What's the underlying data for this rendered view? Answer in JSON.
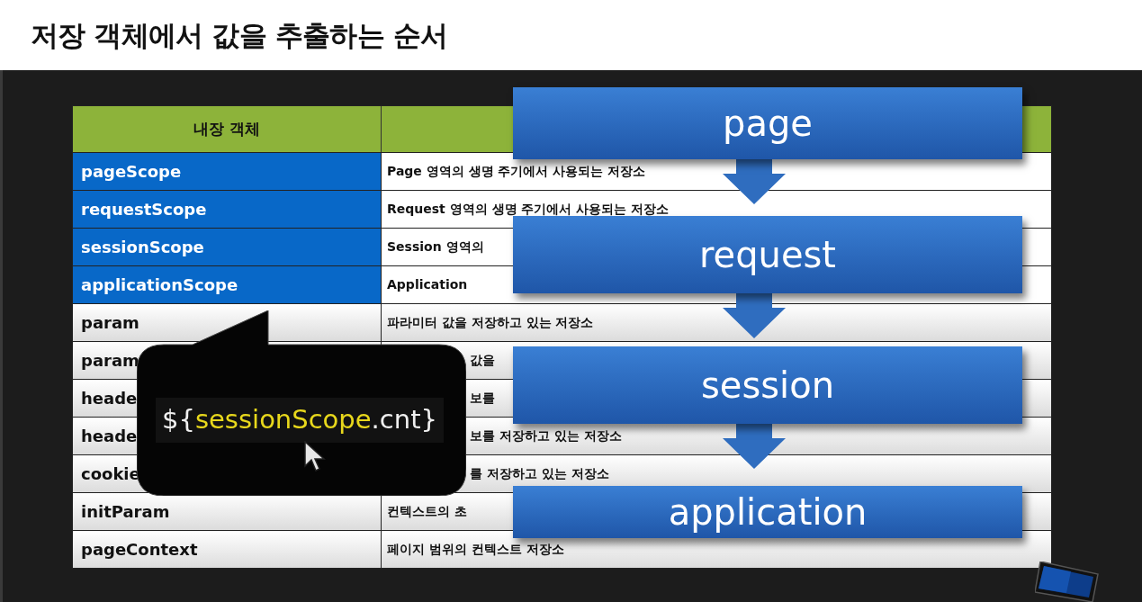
{
  "title": "저장 객체에서 값을 추출하는 순서",
  "table": {
    "header": "내장 객체",
    "rows": [
      {
        "name": "pageScope",
        "description": "Page 영역의 생명 주기에서 사용되는 저장소",
        "highlighted": true
      },
      {
        "name": "requestScope",
        "description": "Request 영역의 생명 주기에서 사용되는 저장소",
        "highlighted": true
      },
      {
        "name": "sessionScope",
        "description": "Session 영역의",
        "highlighted": true
      },
      {
        "name": "applicationScope",
        "description": "Application",
        "highlighted": true
      },
      {
        "name": "param",
        "description": "파라미터 값을 저장하고 있는 저장소",
        "highlighted": false
      },
      {
        "name": "param",
        "description": "값을",
        "highlighted": false,
        "covered": true
      },
      {
        "name": "heade",
        "description": "보를",
        "highlighted": false,
        "covered": true
      },
      {
        "name": "heade",
        "description": "보를 저장하고 있는 저장소",
        "highlighted": false,
        "covered": true
      },
      {
        "name": "cookie",
        "description": "를 저장하고 있는 저장소",
        "highlighted": false,
        "covered": true
      },
      {
        "name": "initParam",
        "description": "컨텍스트의 초",
        "highlighted": false
      },
      {
        "name": "pageContext",
        "description": "페이지 범위의 컨텍스트 저장소",
        "highlighted": false
      }
    ]
  },
  "flow": [
    {
      "label": "page"
    },
    {
      "label": "request"
    },
    {
      "label": "session"
    },
    {
      "label": "application"
    }
  ],
  "callout": {
    "parts": [
      {
        "text": "${",
        "highlight": false
      },
      {
        "text": "sessionScope",
        "highlight": true
      },
      {
        "text": ".cnt}",
        "highlight": false
      }
    ]
  }
}
